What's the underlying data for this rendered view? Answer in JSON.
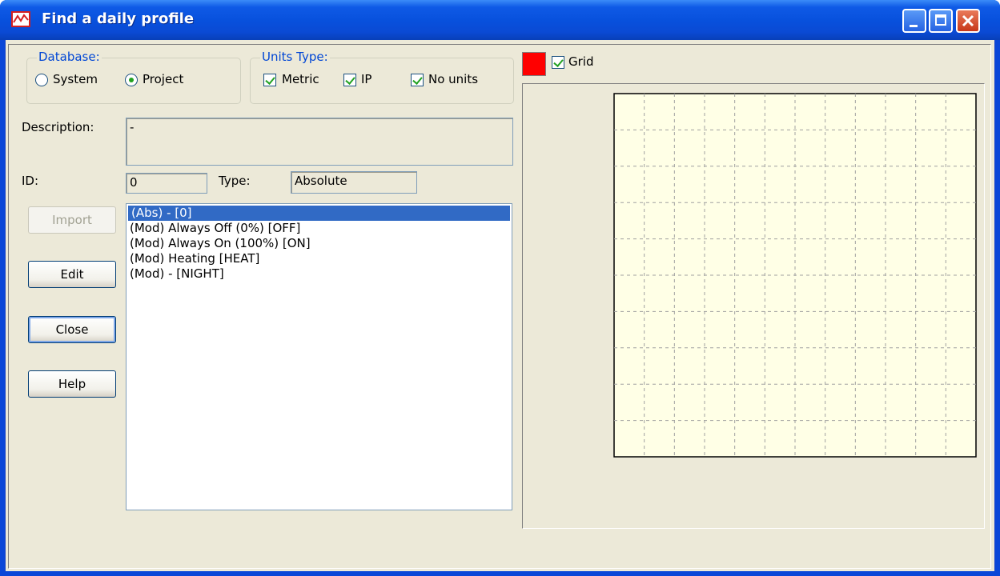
{
  "window": {
    "title": "Find a daily profile",
    "title_icon": "profile-graph-icon",
    "controls": [
      "minimize-icon",
      "maximize-icon",
      "close-icon"
    ]
  },
  "database": {
    "label": "Database:",
    "options": [
      {
        "label": "System",
        "checked": false
      },
      {
        "label": "Project",
        "checked": true
      }
    ]
  },
  "units_type": {
    "label": "Units Type:",
    "options": [
      {
        "label": "Metric",
        "checked": true
      },
      {
        "label": "IP",
        "checked": true
      },
      {
        "label": "No units",
        "checked": true
      }
    ]
  },
  "description": {
    "label": "Description:",
    "value": "-"
  },
  "id": {
    "label": "ID:",
    "value": "0"
  },
  "type": {
    "label": "Type:",
    "value": "Absolute"
  },
  "buttons": {
    "import": "Import",
    "edit": "Edit",
    "close": "Close",
    "help": "Help"
  },
  "profiles": [
    "(Abs) - [0]",
    "(Mod) Always Off (0%) [OFF]",
    "(Mod) Always On (100%) [ON]",
    "(Mod) Heating [HEAT]",
    "(Mod) - [NIGHT]"
  ],
  "selected_profile": 0,
  "chart": {
    "grid_label": "Grid",
    "grid_checked": true,
    "line_color": "#ff0000",
    "plot_background": "#ffffe6"
  },
  "chart_data": {
    "type": "line",
    "title": "",
    "xlabel": "",
    "ylabel": "",
    "grid": true,
    "series": []
  }
}
